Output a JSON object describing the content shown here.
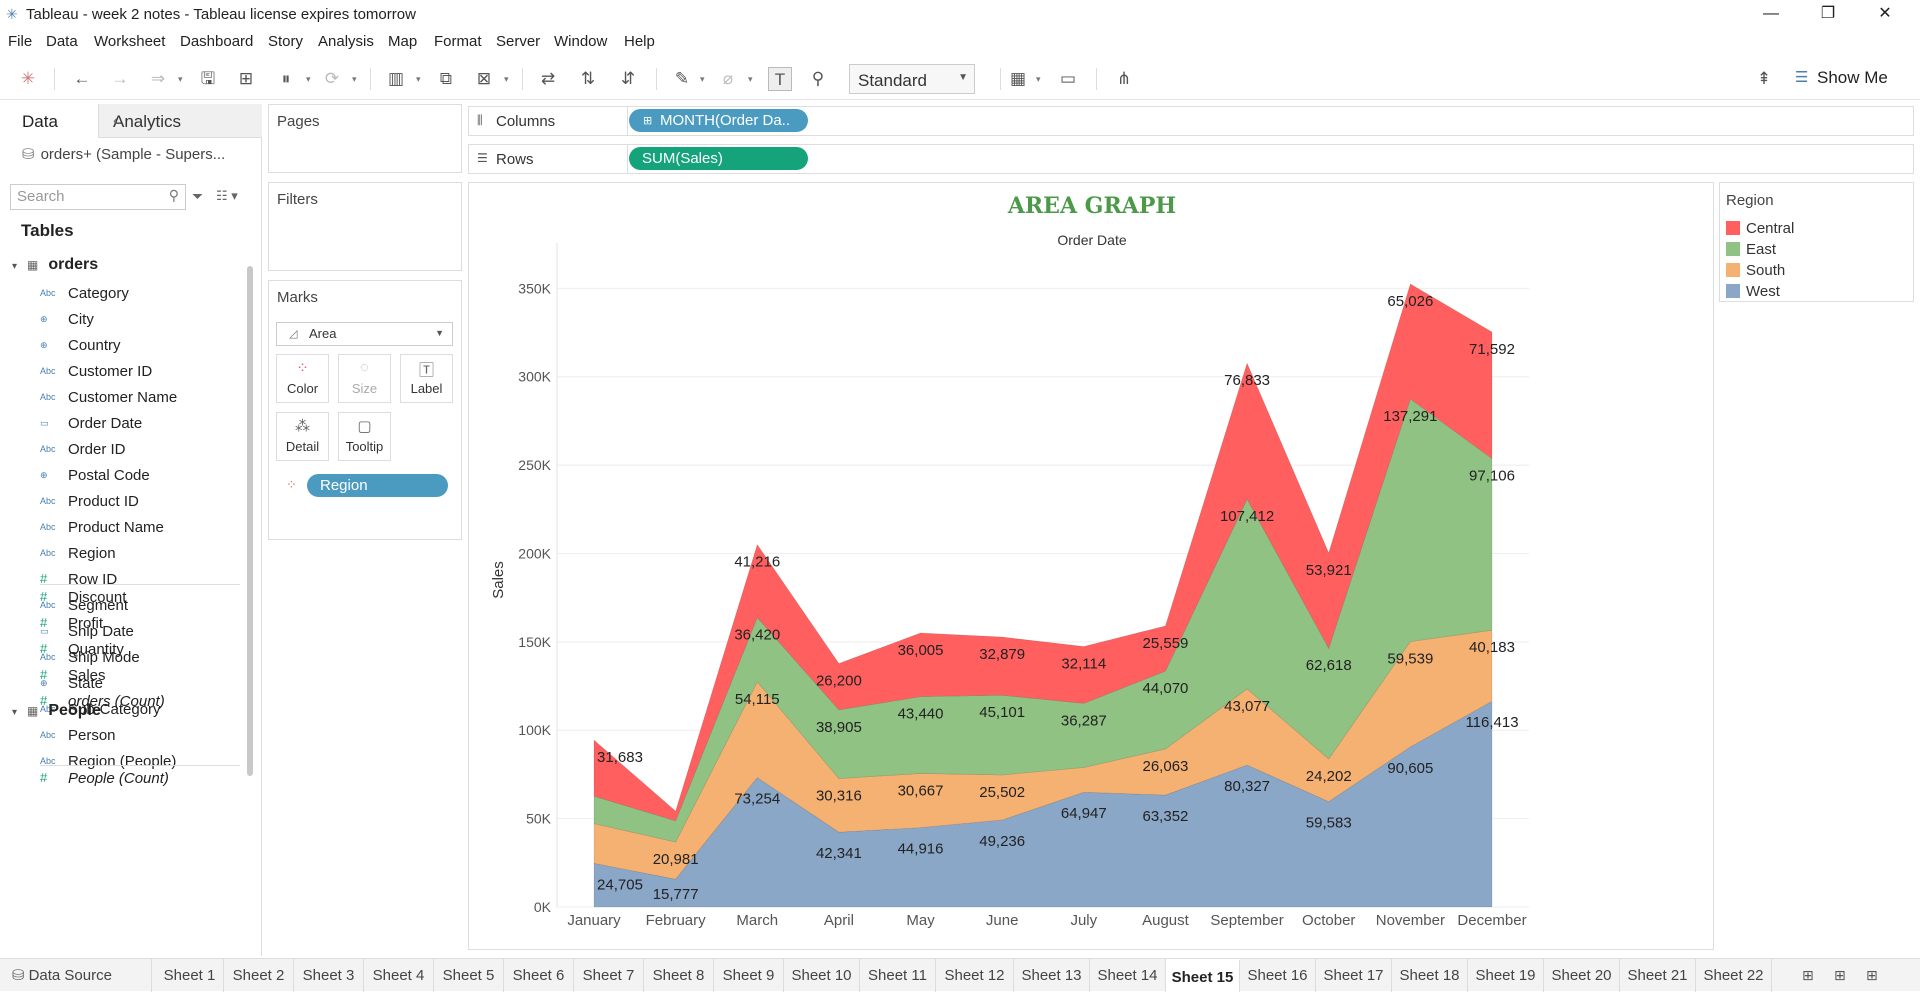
{
  "window": {
    "title": "Tableau - week 2 notes - Tableau license expires tomorrow",
    "minimize": "—",
    "restore": "❐",
    "close": "✕"
  },
  "menu": [
    "File",
    "Data",
    "Worksheet",
    "Dashboard",
    "Story",
    "Analysis",
    "Map",
    "Format",
    "Server",
    "Window",
    "Help"
  ],
  "toolbar": {
    "fit_value": "Standard",
    "show_me_label": "Show Me"
  },
  "data_pane": {
    "tab_data": "Data",
    "tab_analytics": "Analytics",
    "datasource": "orders+ (Sample - Supers...",
    "search_placeholder": "Search",
    "tables_header": "Tables",
    "orders_table": "orders",
    "orders_fields": [
      {
        "icon": "Abc",
        "name": "Category"
      },
      {
        "icon": "⊕",
        "name": "City"
      },
      {
        "icon": "⊕",
        "name": "Country"
      },
      {
        "icon": "Abc",
        "name": "Customer ID"
      },
      {
        "icon": "Abc",
        "name": "Customer Name"
      },
      {
        "icon": "▭",
        "name": "Order Date"
      },
      {
        "icon": "Abc",
        "name": "Order ID"
      },
      {
        "icon": "⊕",
        "name": "Postal Code"
      },
      {
        "icon": "Abc",
        "name": "Product ID"
      },
      {
        "icon": "Abc",
        "name": "Product Name"
      },
      {
        "icon": "Abc",
        "name": "Region"
      },
      {
        "icon": "#",
        "name": "Row ID"
      },
      {
        "icon": "Abc",
        "name": "Segment"
      },
      {
        "icon": "▭",
        "name": "Ship Date"
      },
      {
        "icon": "Abc",
        "name": "Ship Mode"
      },
      {
        "icon": "⊕",
        "name": "State"
      },
      {
        "icon": "Abc",
        "name": "Sub-Category"
      }
    ],
    "orders_measures": [
      {
        "icon": "#",
        "name": "Discount"
      },
      {
        "icon": "#",
        "name": "Profit"
      },
      {
        "icon": "#",
        "name": "Quantity"
      },
      {
        "icon": "#",
        "name": "Sales"
      },
      {
        "icon": "#",
        "name": "orders (Count)"
      }
    ],
    "people_table": "People",
    "people_fields": [
      {
        "icon": "Abc",
        "name": "Person"
      },
      {
        "icon": "Abc",
        "name": "Region (People)"
      }
    ],
    "people_measures": [
      {
        "icon": "#",
        "name": "People (Count)"
      }
    ]
  },
  "cards": {
    "pages": "Pages",
    "filters": "Filters",
    "marks": "Marks",
    "mark_type": "Area",
    "mark_buttons": {
      "color": "Color",
      "size": "Size",
      "label": "Label",
      "detail": "Detail",
      "tooltip": "Tooltip"
    },
    "region_pill": "Region"
  },
  "shelves": {
    "columns_label": "Columns",
    "columns_pill": "MONTH(Order Da..",
    "rows_label": "Rows",
    "rows_pill": "SUM(Sales)"
  },
  "legend": {
    "title": "Region",
    "items": [
      {
        "name": "Central",
        "color": "#ff5f5f"
      },
      {
        "name": "East",
        "color": "#8fc283"
      },
      {
        "name": "South",
        "color": "#f5b172"
      },
      {
        "name": "West",
        "color": "#8aa7c8"
      }
    ]
  },
  "chart_data": {
    "type": "area",
    "stacked": true,
    "title": "AREA GRAPH",
    "subtitle": "Order Date",
    "xlabel": "",
    "ylabel": "Sales",
    "categories": [
      "January",
      "February",
      "March",
      "April",
      "May",
      "June",
      "July",
      "August",
      "September",
      "October",
      "November",
      "December"
    ],
    "y_ticks": [
      "0K",
      "50K",
      "100K",
      "150K",
      "200K",
      "250K",
      "300K",
      "350K"
    ],
    "ylim": [
      0,
      370000
    ],
    "series": [
      {
        "name": "West",
        "color": "#8aa7c8",
        "values": [
          24705,
          15777,
          73254,
          42341,
          44916,
          49236,
          64947,
          63352,
          80327,
          59583,
          90605,
          116413
        ]
      },
      {
        "name": "South",
        "color": "#f5b172",
        "values": [
          22500,
          20981,
          54115,
          30316,
          30667,
          25502,
          14000,
          26063,
          43077,
          24202,
          59539,
          40183
        ]
      },
      {
        "name": "East",
        "color": "#8fc283",
        "values": [
          15500,
          12000,
          36420,
          38905,
          43440,
          45101,
          36287,
          44070,
          107412,
          62618,
          137291,
          97106
        ]
      },
      {
        "name": "Central",
        "color": "#ff5f5f",
        "values": [
          31683,
          5500,
          41216,
          26200,
          36005,
          32879,
          32114,
          25559,
          76833,
          53921,
          65026,
          71592
        ]
      }
    ],
    "data_labels": [
      {
        "series": "West",
        "labels": [
          "24,705",
          "15,777",
          "73,254",
          "42,341",
          "44,916",
          "49,236",
          "64,947",
          "63,352",
          "80,327",
          "59,583",
          "90,605",
          "116,413"
        ]
      },
      {
        "series": "South",
        "labels": [
          "",
          "20,981",
          "54,115",
          "30,316",
          "30,667",
          "25,502",
          "",
          "26,063",
          "43,077",
          "24,202",
          "59,539",
          "40,183"
        ]
      },
      {
        "series": "East",
        "labels": [
          "",
          "",
          "36,420",
          "38,905",
          "43,440",
          "45,101",
          "36,287",
          "44,070",
          "107,412",
          "62,618",
          "137,291",
          "97,106"
        ]
      },
      {
        "series": "Central",
        "labels": [
          "31,683",
          "",
          "41,216",
          "26,200",
          "36,005",
          "32,879",
          "32,114",
          "25,559",
          "76,833",
          "53,921",
          "65,026",
          "71,592"
        ]
      }
    ],
    "grid": true,
    "legend_position": "right"
  },
  "sheet_tabs": {
    "data_source": "Data Source",
    "tabs": [
      "Sheet 1",
      "Sheet 2",
      "Sheet 3",
      "Sheet 4",
      "Sheet 5",
      "Sheet 6",
      "Sheet 7",
      "Sheet 8",
      "Sheet 9",
      "Sheet 10",
      "Sheet 11",
      "Sheet 12",
      "Sheet 13",
      "Sheet 14",
      "Sheet 15",
      "Sheet 16",
      "Sheet 17",
      "Sheet 18",
      "Sheet 19",
      "Sheet 20",
      "Sheet 21",
      "Sheet 22"
    ],
    "active": "Sheet 15"
  }
}
